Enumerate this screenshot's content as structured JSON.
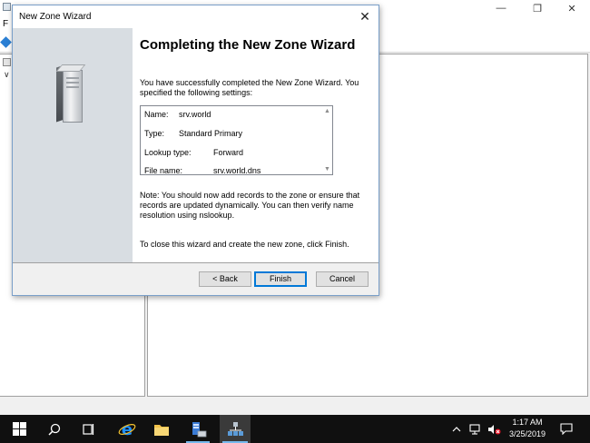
{
  "background_window": {
    "menu_letter": "F"
  },
  "dialog": {
    "title": "New Zone Wizard",
    "close_glyph": "✕",
    "heading": "Completing the New Zone Wizard",
    "intro": "You have successfully completed the New Zone Wizard. You specified the following settings:",
    "settings": [
      {
        "key": "Name:",
        "value": "srv.world"
      },
      {
        "key": "Type:",
        "value": "Standard Primary"
      },
      {
        "key": "Lookup type:",
        "value": "Forward"
      },
      {
        "key": "File name:",
        "value": "srv.world.dns"
      }
    ],
    "note": "Note: You should now add records to the zone or ensure that records are updated dynamically. You can then verify name resolution using nslookup.",
    "finish_hint": "To close this wizard and create the new zone, click Finish.",
    "buttons": {
      "back": "< Back",
      "finish": "Finish",
      "cancel": "Cancel"
    }
  },
  "taskbar": {
    "clock_time": "1:17 AM",
    "clock_date": "3/25/2019",
    "icons": [
      "windows-start-icon",
      "search-icon",
      "task-view-icon",
      "internet-explorer-icon",
      "file-explorer-icon",
      "server-manager-icon",
      "dns-manager-icon"
    ],
    "tray_icons": [
      "chevron-up-icon",
      "network-icon",
      "volume-muted-icon",
      "notifications-icon"
    ]
  },
  "colors": {
    "taskbar": "#101010",
    "accent": "#0078d7",
    "sidebar": "#d8dde2"
  }
}
